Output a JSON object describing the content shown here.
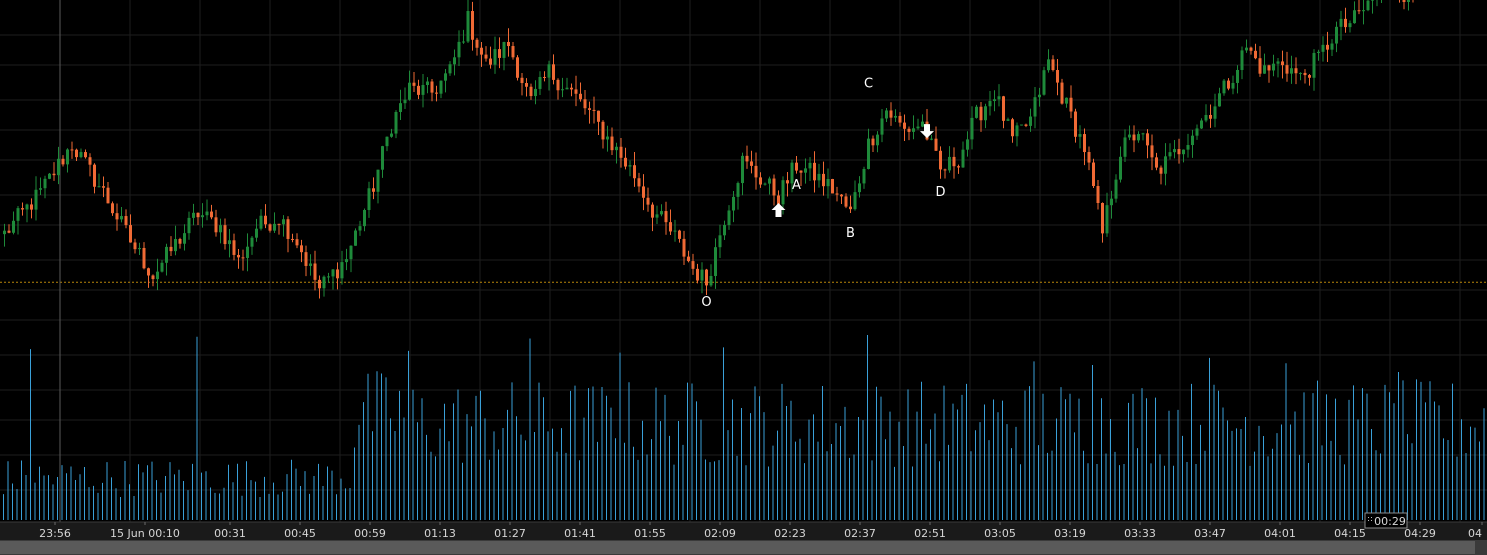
{
  "chart_data": {
    "type": "candlestick",
    "grid": true,
    "colors": {
      "background": "#000000",
      "grid": "#1e1e1e",
      "up": "#1e8a3a",
      "down": "#f06a35",
      "volume": "#3aa0d8",
      "price_line": "#b8860b",
      "cursor_line": "#5a5a5a",
      "axis_text": "#d6d6d6",
      "xaxis_bg": "#1a1a1a",
      "scrollbar": "#5a5a5a"
    },
    "x_ticks": [
      "23:56",
      "15 Jun 00:10",
      "00:31",
      "00:45",
      "00:59",
      "01:13",
      "01:27",
      "01:41",
      "01:55",
      "02:09",
      "02:23",
      "02:37",
      "02:51",
      "03:05",
      "03:19",
      "03:33",
      "03:47",
      "04:01",
      "04:15",
      "04:29",
      "04"
    ],
    "price_range": [
      0,
      100
    ],
    "price_line_level": 24,
    "cursor_label": "00:29",
    "price_path": [
      [
        0,
        38
      ],
      [
        8,
        50
      ],
      [
        15,
        64
      ],
      [
        22,
        50
      ],
      [
        28,
        36
      ],
      [
        33,
        26
      ],
      [
        38,
        35
      ],
      [
        43,
        44
      ],
      [
        48,
        40
      ],
      [
        52,
        30
      ],
      [
        56,
        40
      ],
      [
        61,
        43
      ],
      [
        65,
        36
      ],
      [
        70,
        22
      ],
      [
        76,
        31
      ],
      [
        82,
        52
      ],
      [
        86,
        70
      ],
      [
        90,
        80
      ],
      [
        95,
        79
      ],
      [
        99,
        85
      ],
      [
        103,
        100
      ],
      [
        107,
        87
      ],
      [
        112,
        93
      ],
      [
        117,
        76
      ],
      [
        121,
        85
      ],
      [
        126,
        79
      ],
      [
        130,
        73
      ],
      [
        135,
        64
      ],
      [
        140,
        55
      ],
      [
        144,
        45
      ],
      [
        149,
        37
      ],
      [
        153,
        28
      ],
      [
        156,
        24
      ],
      [
        160,
        43
      ],
      [
        164,
        59
      ],
      [
        168,
        54
      ],
      [
        172,
        49
      ],
      [
        176,
        58
      ],
      [
        180,
        55
      ],
      [
        184,
        51
      ],
      [
        188,
        44
      ],
      [
        192,
        64
      ],
      [
        196,
        74
      ],
      [
        200,
        68
      ],
      [
        204,
        70
      ],
      [
        208,
        56
      ],
      [
        212,
        60
      ],
      [
        216,
        72
      ],
      [
        220,
        79
      ],
      [
        224,
        65
      ],
      [
        228,
        71
      ],
      [
        232,
        88
      ],
      [
        236,
        75
      ],
      [
        240,
        63
      ],
      [
        244,
        38
      ],
      [
        248,
        62
      ],
      [
        252,
        68
      ],
      [
        256,
        56
      ],
      [
        260,
        61
      ],
      [
        264,
        68
      ],
      [
        268,
        74
      ],
      [
        272,
        82
      ],
      [
        276,
        92
      ],
      [
        280,
        85
      ],
      [
        284,
        88
      ],
      [
        288,
        83
      ],
      [
        292,
        89
      ],
      [
        296,
        97
      ],
      [
        300,
        100
      ],
      [
        304,
        106
      ],
      [
        308,
        111
      ],
      [
        312,
        106
      ],
      [
        316,
        114
      ],
      [
        320,
        118
      ],
      [
        325,
        114
      ],
      [
        330,
        120
      ]
    ],
    "volume_range": [
      0,
      100
    ],
    "volume_tall": [
      [
        6,
        97
      ],
      [
        43,
        104
      ],
      [
        90,
        96
      ],
      [
        117,
        103
      ],
      [
        137,
        95
      ],
      [
        160,
        98
      ],
      [
        192,
        110
      ],
      [
        229,
        90
      ],
      [
        242,
        88
      ],
      [
        268,
        92
      ],
      [
        285,
        89
      ],
      [
        310,
        84
      ]
    ],
    "annotations": [
      {
        "label": "O",
        "i": 156,
        "price": 24
      },
      {
        "label": "A",
        "i": 176,
        "price": 58
      },
      {
        "label": "B",
        "i": 188,
        "price": 44
      },
      {
        "label": "C",
        "i": 192,
        "price": 74
      },
      {
        "label": "D",
        "i": 208,
        "price": 56
      }
    ],
    "arrows": [
      {
        "direction": "up",
        "i": 172,
        "price": 49
      },
      {
        "direction": "down",
        "i": 205,
        "price": 62
      }
    ]
  }
}
